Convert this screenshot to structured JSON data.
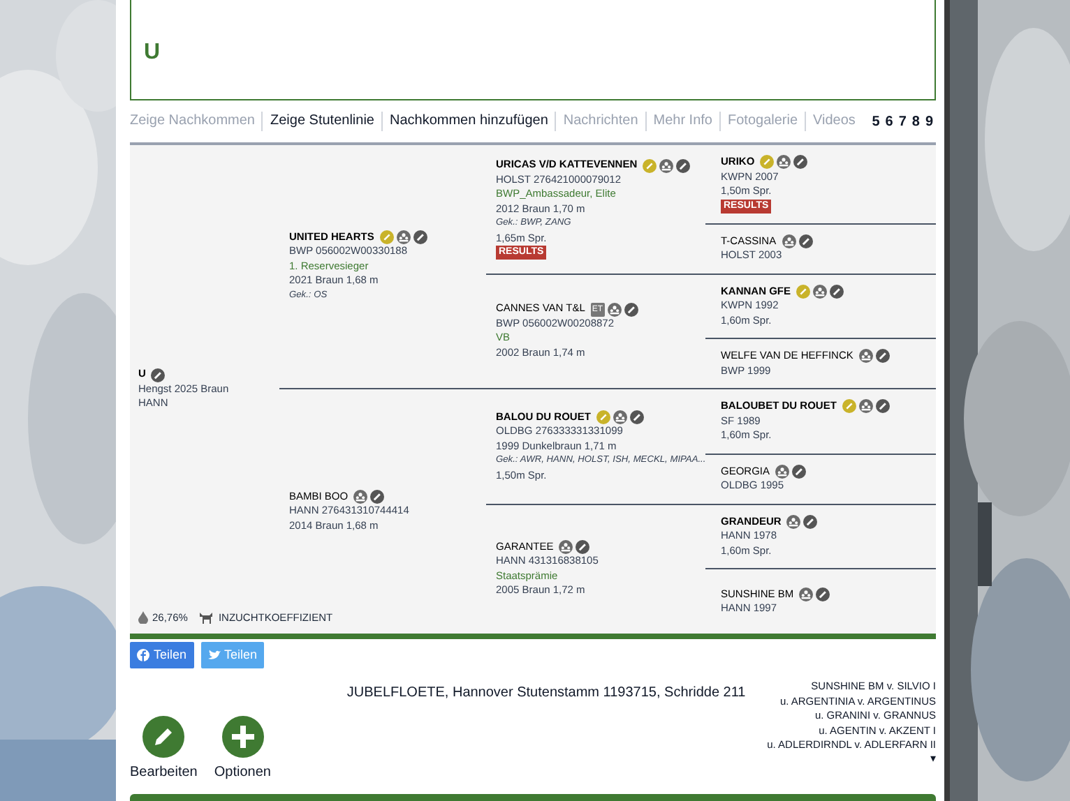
{
  "header": {
    "title": "U"
  },
  "tabs": [
    {
      "label": "Zeige Nachkommen",
      "disabled": true
    },
    {
      "label": "Zeige Stutenlinie",
      "disabled": false
    },
    {
      "label": "Nachkommen hinzufügen",
      "disabled": false
    },
    {
      "label": "Nachrichten",
      "disabled": true
    },
    {
      "label": "Mehr Info",
      "disabled": true
    },
    {
      "label": "Fotogalerie",
      "disabled": true
    },
    {
      "label": "Videos",
      "disabled": true
    }
  ],
  "pages": [
    "5",
    "6",
    "7",
    "8",
    "9"
  ],
  "pedigree": {
    "name": "U",
    "bold": true,
    "icons": {
      "edit": true
    },
    "lines": [
      {
        "kind": "plain",
        "text": "Hengst 2025 Braun"
      },
      {
        "kind": "plain",
        "text": "HANN"
      }
    ],
    "children": [
      {
        "name": "UNITED HEARTS",
        "bold": true,
        "icons": {
          "medal": true,
          "family": true,
          "edit": true
        },
        "lines": [
          {
            "kind": "plain",
            "text": "BWP 056002W00330188"
          },
          {
            "kind": "award",
            "text": "1. Reservesieger"
          },
          {
            "kind": "plain",
            "text": "2021 Braun 1,68 m"
          },
          {
            "kind": "italic",
            "text": "Gek.: OS"
          }
        ],
        "children": [
          {
            "name": "URICAS V/D KATTEVENNEN",
            "bold": true,
            "icons": {
              "medal": true,
              "family": true,
              "edit": true
            },
            "lines": [
              {
                "kind": "plain",
                "text": "HOLST 276421000079012"
              },
              {
                "kind": "award",
                "text": "BWP_Ambassadeur, Elite"
              },
              {
                "kind": "plain",
                "text": "2012 Braun 1,70 m"
              },
              {
                "kind": "italic",
                "text": "Gek.: BWP, ZANG"
              },
              {
                "kind": "plain",
                "text": "1,65m Spr."
              }
            ],
            "results": "RESULTS",
            "children": [
              {
                "name": "URIKO",
                "bold": true,
                "icons": {
                  "medal": true,
                  "family": true,
                  "edit": true
                },
                "lines": [
                  {
                    "kind": "plain",
                    "text": "KWPN 2007"
                  },
                  {
                    "kind": "plain",
                    "text": "1,50m Spr."
                  }
                ],
                "results": "RESULTS"
              },
              {
                "name": "T-CASSINA",
                "bold": false,
                "icons": {
                  "family": true,
                  "edit": true
                },
                "lines": [
                  {
                    "kind": "plain",
                    "text": "HOLST 2003"
                  }
                ]
              }
            ]
          },
          {
            "name": "CANNES VAN T&L",
            "bold": false,
            "tag": "ET",
            "icons": {
              "family": true,
              "edit": true
            },
            "lines": [
              {
                "kind": "plain",
                "text": "BWP 056002W00208872"
              },
              {
                "kind": "award",
                "text": "VB"
              },
              {
                "kind": "plain",
                "text": "2002 Braun 1,74 m"
              }
            ],
            "children": [
              {
                "name": "KANNAN GFE",
                "bold": true,
                "icons": {
                  "medal": true,
                  "family": true,
                  "edit": true
                },
                "lines": [
                  {
                    "kind": "plain",
                    "text": "KWPN 1992"
                  },
                  {
                    "kind": "plain",
                    "text": "1,60m Spr."
                  }
                ]
              },
              {
                "name": "WELFE VAN DE HEFFINCK",
                "bold": false,
                "icons": {
                  "family": true,
                  "edit": true
                },
                "lines": [
                  {
                    "kind": "plain",
                    "text": "BWP 1999"
                  }
                ]
              }
            ]
          }
        ]
      },
      {
        "name": "BAMBI BOO",
        "bold": false,
        "icons": {
          "family": true,
          "edit": true
        },
        "lines": [
          {
            "kind": "plain",
            "text": "HANN 276431310744414"
          },
          {
            "kind": "plain",
            "text": "2014 Braun 1,68 m"
          }
        ],
        "children": [
          {
            "name": "BALOU DU ROUET",
            "bold": true,
            "icons": {
              "medal": true,
              "family": true,
              "edit": true
            },
            "lines": [
              {
                "kind": "plain",
                "text": "OLDBG 276333331331099"
              },
              {
                "kind": "plain",
                "text": "1999 Dunkelbraun 1,71 m"
              },
              {
                "kind": "italic",
                "text": "Gek.: AWR, HANN, HOLST, ISH, MECKL, MIPAA..."
              },
              {
                "kind": "plain",
                "text": "1,50m Spr."
              }
            ],
            "children": [
              {
                "name": "BALOUBET DU ROUET",
                "bold": true,
                "icons": {
                  "medal": true,
                  "family": true,
                  "edit": true
                },
                "lines": [
                  {
                    "kind": "plain",
                    "text": "SF 1989"
                  },
                  {
                    "kind": "plain",
                    "text": "1,60m Spr."
                  }
                ]
              },
              {
                "name": "GEORGIA",
                "bold": false,
                "icons": {
                  "family": true,
                  "edit": true
                },
                "lines": [
                  {
                    "kind": "plain",
                    "text": "OLDBG 1995"
                  }
                ]
              }
            ]
          },
          {
            "name": "GARANTEE",
            "bold": false,
            "icons": {
              "family": true,
              "edit": true
            },
            "lines": [
              {
                "kind": "plain",
                "text": "HANN 431316838105"
              },
              {
                "kind": "award",
                "text": "Staatsprämie"
              },
              {
                "kind": "plain",
                "text": "2005 Braun 1,72 m"
              }
            ],
            "children": [
              {
                "name": "GRANDEUR",
                "bold": true,
                "icons": {
                  "family": true,
                  "edit": true
                },
                "lines": [
                  {
                    "kind": "plain",
                    "text": "HANN 1978"
                  },
                  {
                    "kind": "plain",
                    "text": "1,60m Spr."
                  }
                ]
              },
              {
                "name": "SUNSHINE BM",
                "bold": false,
                "icons": {
                  "family": true,
                  "edit": true
                },
                "lines": [
                  {
                    "kind": "plain",
                    "text": "HANN 1997"
                  }
                ]
              }
            ]
          }
        ]
      }
    ]
  },
  "inbreeding": {
    "value": "26,76%",
    "label": "INZUCHTKOEFFIZIENT"
  },
  "share": [
    {
      "kind": "facebook",
      "label": "Teilen"
    },
    {
      "kind": "twitter",
      "label": "Teilen"
    }
  ],
  "actions": [
    {
      "kind": "edit",
      "label": "Bearbeiten"
    },
    {
      "kind": "add",
      "label": "Optionen"
    }
  ],
  "mare_line": {
    "title": "JUBELFLOETE, Hannover Stutenstamm 1193715, Schridde 211",
    "lines": [
      "SUNSHINE BM v. SILVIO I",
      "u. ARGENTINIA v. ARGENTINUS",
      "u. GRANINI v. GRANNUS",
      "u. AGENTIN v. AKZENT I",
      "u. ADLERDIRNDL v. ADLERFARN II"
    ],
    "more": "▾"
  }
}
